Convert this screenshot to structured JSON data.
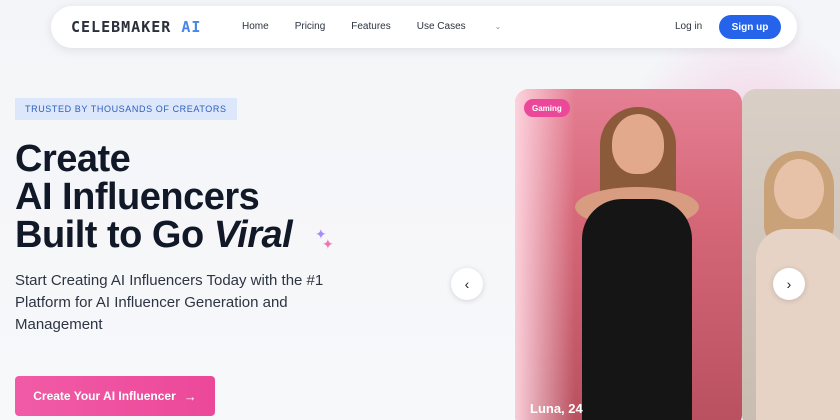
{
  "nav": {
    "logo_main": "CELEBMAKER",
    "logo_accent": "AI",
    "links": [
      "Home",
      "Pricing",
      "Features",
      "Use Cases"
    ],
    "dropdown_icon": "chevron-down-icon",
    "login": "Log in",
    "signup": "Sign up"
  },
  "hero": {
    "badge": "TRUSTED BY THOUSANDS OF CREATORS",
    "headline_line1": "Create",
    "headline_line2": "AI Influencers",
    "headline_line3_prefix": "Built to Go ",
    "headline_line3_accent": "Viral",
    "subtitle": "Start Creating AI Influencers Today with the #1 Platform for AI Influencer Generation and Management",
    "cta": "Create Your AI Influencer",
    "cta_arrow": "→"
  },
  "carousel": {
    "active_card": {
      "tag": "Gaming",
      "name": "Luna, 24"
    },
    "prev_icon": "‹",
    "next_icon": "›"
  },
  "colors": {
    "primary": "#2563eb",
    "cta_pink": "#ec4899",
    "badge_bg": "#dce7fb"
  }
}
